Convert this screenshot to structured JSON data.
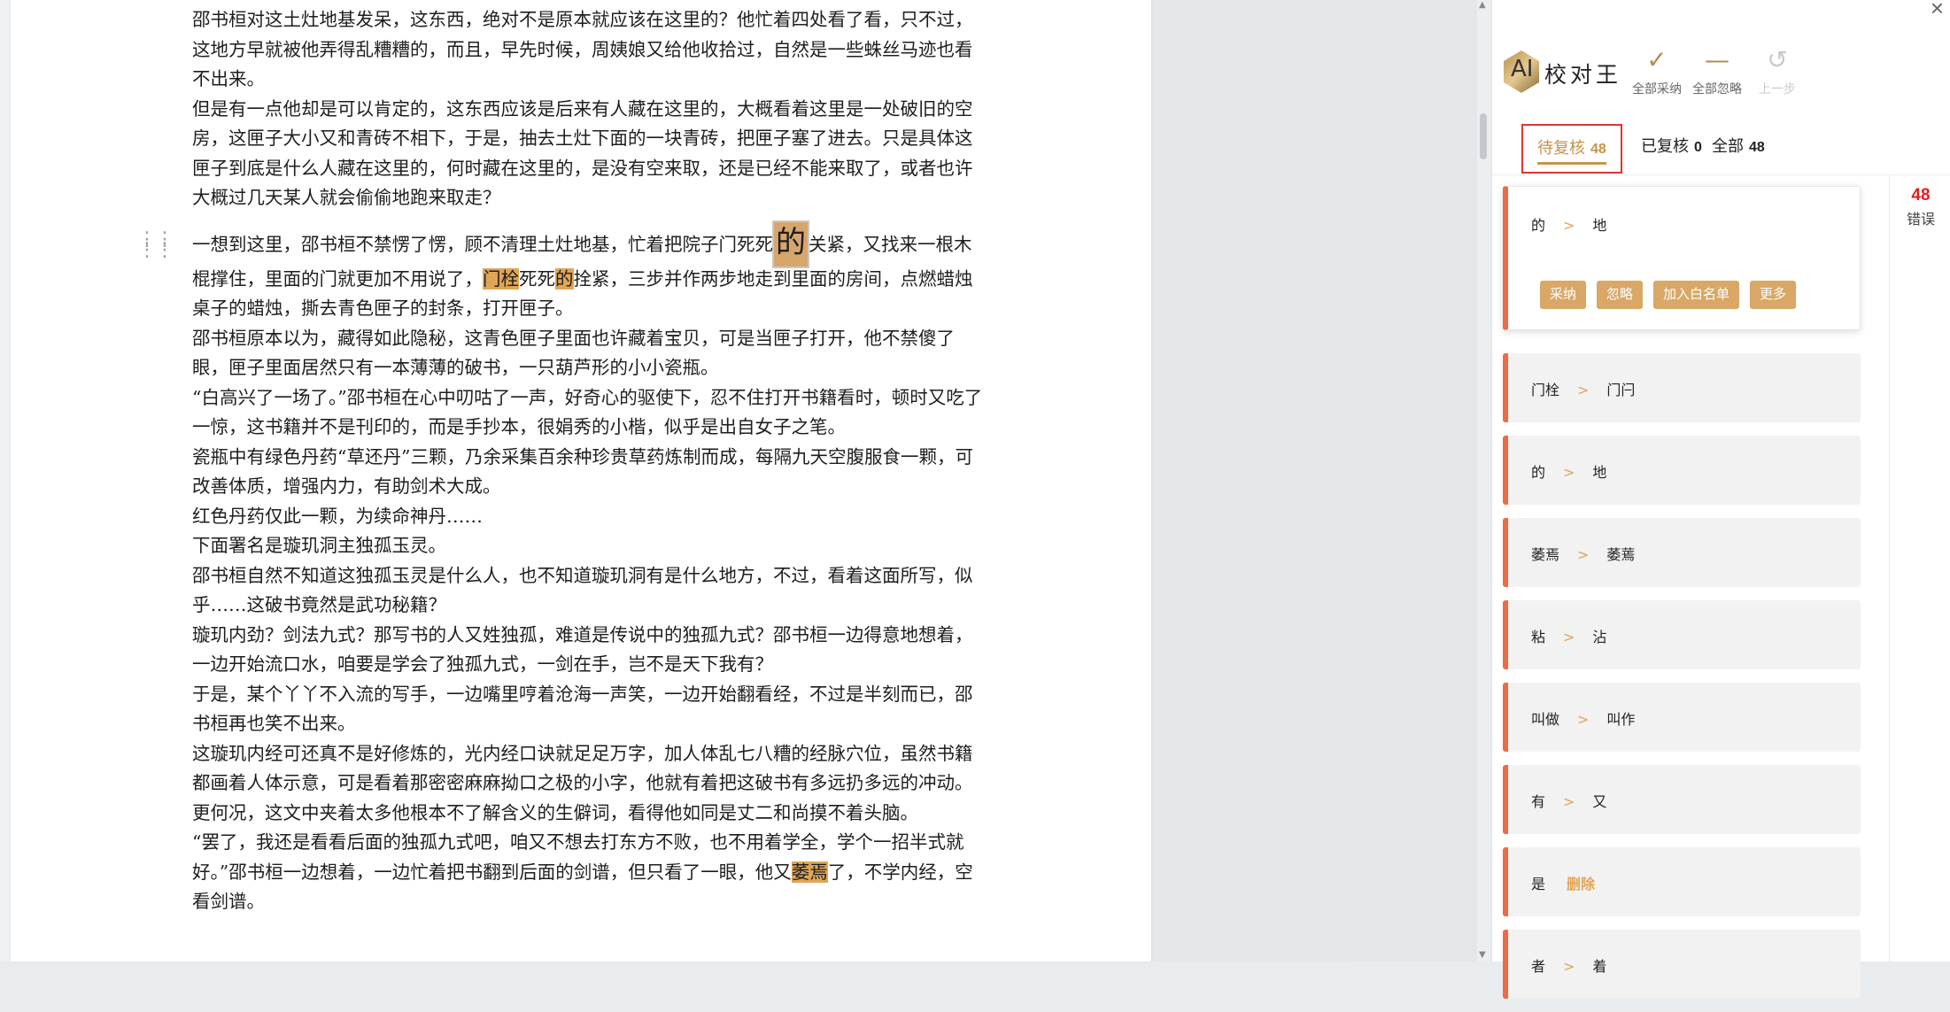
{
  "document": {
    "paragraphs": [
      {
        "segments": [
          {
            "t": "邵书桓对这土灶地基发呆，这东西，绝对不是原本就应该在这里的？他忙着四处看了看，只不过，这地方早就被他弄得乱糟糟的，而且，早先时候，周姨娘又给他收拾过，自然是一些蛛丝马迹也看不出来。"
          }
        ]
      },
      {
        "segments": [
          {
            "t": "但是有一点他却是可以肯定的，这东西应该是后来有人藏在这里的，大概看着这里是一处破旧的空房，这匣子大小又和青砖不相下，于是，抽去土灶下面的一块青砖，把匣子塞了进去。只是具体这匣子到底是什么人藏在这里的，何时藏在这里的，是没有空来取，还是已经不能来取了，或者也许大概过几天某人就会偷偷地跑来取走？"
          }
        ]
      },
      {
        "segments": [
          {
            "t": "一想到这里，邵书桓不禁愣了愣，顾不清理土灶地基，忙着把院子门死死"
          },
          {
            "t": "的",
            "mark": "big"
          },
          {
            "t": "关紧，又找来一根木棍撑住，里面的门就更加不用说了，"
          },
          {
            "t": "门栓",
            "mark": "hl"
          },
          {
            "t": "死死"
          },
          {
            "t": "的",
            "mark": "hl"
          },
          {
            "t": "拴紧，三步并作两步地走到里面的房间，点燃蜡烛桌子的蜡烛，撕去青色匣子的封条，打开匣子。"
          }
        ],
        "gap": true
      },
      {
        "segments": [
          {
            "t": "邵书桓原本以为，藏得如此隐秘，这青色匣子里面也许藏着宝贝，可是当匣子打开，他不禁傻了眼，匣子里面居然只有一本薄薄的破书，一只葫芦形的小小瓷瓶。"
          }
        ]
      },
      {
        "segments": [
          {
            "t": "“白高兴了一场了。”邵书桓在心中叨咕了一声，好奇心的驱使下，忍不住打开书籍看时，顿时又吃了一惊，这书籍并不是刊印的，而是手抄本，很娟秀的小楷，似乎是出自女子之笔。"
          }
        ]
      },
      {
        "segments": [
          {
            "t": "瓷瓶中有绿色丹药“草还丹”三颗，乃余采集百余种珍贵草药炼制而成，每隔九天空腹服食一颗，可改善体质，增强内力，有助剑术大成。"
          }
        ]
      },
      {
        "segments": [
          {
            "t": "红色丹药仅此一颗，为续命神丹……"
          }
        ]
      },
      {
        "segments": [
          {
            "t": "下面署名是璇玑洞主独孤玉灵。"
          }
        ]
      },
      {
        "segments": [
          {
            "t": "邵书桓自然不知道这独孤玉灵是什么人，也不知道璇玑洞有是什么地方，不过，看着这面所写，似乎……这破书竟然是武功秘籍？"
          }
        ]
      },
      {
        "segments": [
          {
            "t": "璇玑内劲？剑法九式？那写书的人又姓独孤，难道是传说中的独孤九式？邵书桓一边得意地想着，一边开始流口水，咱要是学会了独孤九式，一剑在手，岂不是天下我有？"
          }
        ]
      },
      {
        "segments": [
          {
            "t": "于是，某个丫丫不入流的写手，一边嘴里哼着沧海一声笑，一边开始翻看经，不过是半刻而已，邵书桓再也笑不出来。"
          }
        ]
      },
      {
        "segments": [
          {
            "t": "这璇玑内经可还真不是好修炼的，光内经口诀就足足万字，加人体乱七八糟的经脉穴位，虽然书籍都画着人体示意，可是看着那密密麻麻拗口之极的小字，他就有着把这破书有多远扔多远的冲动。"
          }
        ]
      },
      {
        "segments": [
          {
            "t": "更何况，这文中夹着太多他根本不了解含义的生僻词，看得他如同是丈二和尚摸不着头脑。"
          }
        ]
      },
      {
        "segments": [
          {
            "t": "“罢了，我还是看看后面的独孤九式吧，咱又不想去打东方不败，也不用着学全，学个一招半式就好。”邵书桓一边想着，一边忙着把书翻到后面的剑谱，但只看了一眼，他又"
          },
          {
            "t": "萎焉",
            "mark": "hl"
          },
          {
            "t": "了，不学内经，空看剑谱。"
          }
        ]
      }
    ]
  },
  "panel": {
    "close": "×",
    "logo": {
      "ai": "AI",
      "name": "校对王"
    },
    "toolbar": [
      {
        "icon": "✓",
        "label": "全部采纳",
        "enabled": true,
        "name": "accept-all"
      },
      {
        "icon": "—",
        "label": "全部忽略",
        "enabled": true,
        "name": "ignore-all"
      },
      {
        "icon": "↺",
        "label": "上一步",
        "enabled": false,
        "name": "undo"
      }
    ],
    "tabs": [
      {
        "label": "待复核",
        "count": "48",
        "active": true
      },
      {
        "label": "已复核",
        "count": "0",
        "active": false
      },
      {
        "label": "全部",
        "count": "48",
        "active": false
      }
    ],
    "error_count": "48",
    "error_label": "错误",
    "arrow": ">",
    "actions": [
      "采纳",
      "忽略",
      "加入白名单",
      "更多"
    ],
    "cards": [
      {
        "from": "的",
        "to": "地",
        "expanded": true
      },
      {
        "from": "门栓",
        "to": "门闩"
      },
      {
        "from": "的",
        "to": "地"
      },
      {
        "from": "萎焉",
        "to": "萎蔫"
      },
      {
        "from": "粘",
        "to": "沾"
      },
      {
        "from": "叫做",
        "to": "叫作"
      },
      {
        "from": "有",
        "to": "又"
      },
      {
        "from": "是",
        "delete": "删除"
      },
      {
        "from": "者",
        "to": "着"
      }
    ]
  }
}
